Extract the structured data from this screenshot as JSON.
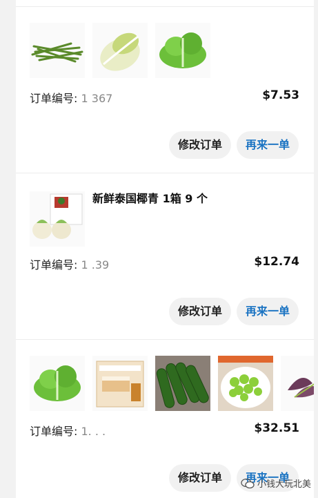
{
  "orders": [
    {
      "order_label": "订单编号:",
      "order_number": "1      367",
      "price": "$7.53",
      "modify_label": "修改订单",
      "again_label": "再来一单",
      "items": [
        "green-beans",
        "napa-cabbage",
        "lettuce"
      ]
    },
    {
      "product_title": "新鲜泰国椰青 1箱 9 个",
      "order_label": "订单编号:",
      "order_number": "1     .39",
      "price": "$12.74",
      "modify_label": "修改订单",
      "again_label": "再来一单",
      "items": [
        "coconut-box"
      ]
    },
    {
      "order_label": "订单编号:",
      "order_number": "1.    . .",
      "price": "$32.51",
      "modify_label": "修改订单",
      "again_label": "再来一单",
      "items": [
        "lettuce",
        "cake-box",
        "zucchini",
        "edamame",
        "leafy-greens"
      ]
    }
  ],
  "watermark": "小钱大玩北美",
  "colors": {
    "accent": "#1a73c2",
    "button_bg": "#f1f1f1",
    "page_bg": "#f2f2f2"
  }
}
